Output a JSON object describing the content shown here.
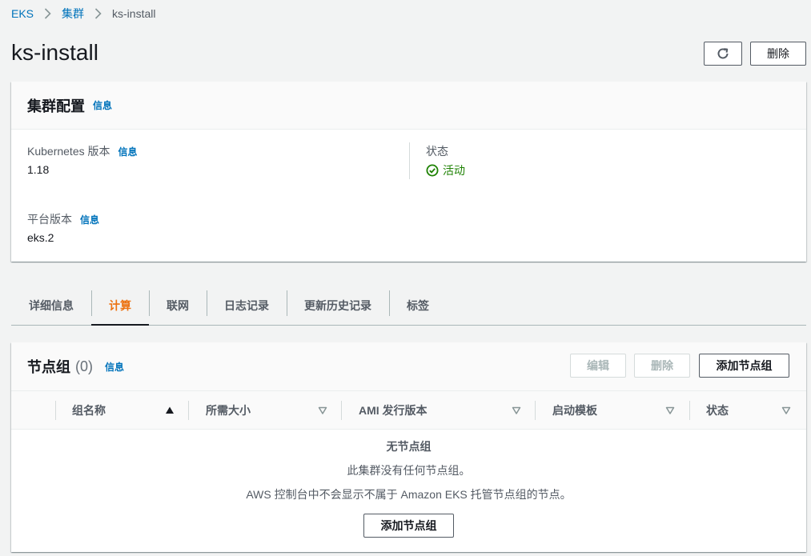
{
  "breadcrumb": {
    "root": "EKS",
    "clusters": "集群",
    "current": "ks-install"
  },
  "page": {
    "title": "ks-install",
    "delete_label": "删除"
  },
  "config": {
    "title": "集群配置",
    "info": "信息",
    "k8s_label": "Kubernetes 版本",
    "k8s_value": "1.18",
    "status_label": "状态",
    "status_value": "活动",
    "platform_label": "平台版本",
    "platform_value": "eks.2"
  },
  "tabs": [
    "详细信息",
    "计算",
    "联网",
    "日志记录",
    "更新历史记录",
    "标签"
  ],
  "nodegroups": {
    "title": "节点组",
    "count": "(0)",
    "info": "信息",
    "edit_label": "编辑",
    "delete_label": "删除",
    "add_label": "添加节点组",
    "columns": [
      "组名称",
      "所需大小",
      "AMI 发行版本",
      "启动模板",
      "状态"
    ],
    "empty_title": "无节点组",
    "empty_desc": "此集群没有任何节点组。",
    "empty_note": "AWS 控制台中不会显示不属于 Amazon EKS 托管节点组的节点。",
    "empty_add_label": "添加节点组"
  },
  "colors": {
    "link": "#0073bb",
    "active_tab": "#ec7211",
    "success": "#1d8102"
  }
}
